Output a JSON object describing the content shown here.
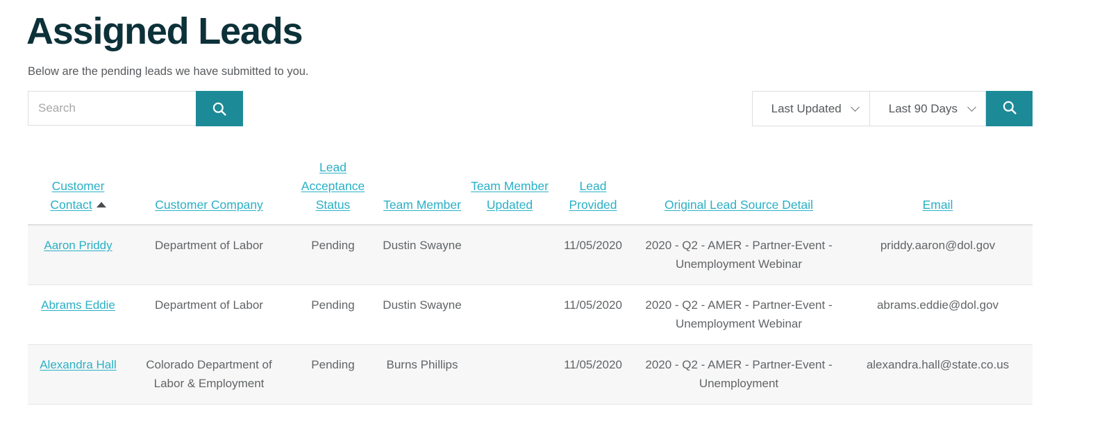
{
  "header": {
    "title": "Assigned Leads",
    "subtitle": "Below are the pending leads we have submitted to you."
  },
  "search": {
    "placeholder": "Search",
    "value": "",
    "button_icon": "search-icon"
  },
  "filters": {
    "sort_by": {
      "selected": "Last Updated",
      "icon": "chevron-down-icon"
    },
    "date_range": {
      "selected": "Last 90 Days",
      "icon": "chevron-down-icon"
    },
    "apply_icon": "search-icon"
  },
  "table": {
    "sorted_column": "Customer Contact",
    "sort_direction": "ascending",
    "columns": [
      "Customer Contact",
      "Customer Company",
      "Lead Acceptance Status",
      "Team Member",
      "Team Member Updated",
      "Lead Provided",
      "Original Lead Source Detail",
      "Email"
    ],
    "rows": [
      {
        "customer_contact": "Aaron Priddy",
        "customer_company": "Department of Labor",
        "lead_acceptance_status": "Pending",
        "team_member": "Dustin Swayne",
        "team_member_updated": "",
        "lead_provided": "11/05/2020",
        "original_lead_source_detail": "2020 - Q2 - AMER - Partner-Event - Unemployment Webinar",
        "email": "priddy.aaron@dol.gov"
      },
      {
        "customer_contact": "Abrams Eddie",
        "customer_company": "Department of Labor",
        "lead_acceptance_status": "Pending",
        "team_member": "Dustin Swayne",
        "team_member_updated": "",
        "lead_provided": "11/05/2020",
        "original_lead_source_detail": "2020 - Q2 - AMER - Partner-Event - Unemployment Webinar",
        "email": "abrams.eddie@dol.gov"
      },
      {
        "customer_contact": "Alexandra Hall",
        "customer_company": "Colorado Department of Labor & Employment",
        "lead_acceptance_status": "Pending",
        "team_member": "Burns Phillips",
        "team_member_updated": "",
        "lead_provided": "11/05/2020",
        "original_lead_source_detail": "2020 - Q2 - AMER - Partner-Event - Unemployment",
        "email": "alexandra.hall@state.co.us"
      }
    ]
  },
  "colors": {
    "brand_teal": "#1d8a97",
    "link_teal": "#29b0c6",
    "title_dark": "#0c3139",
    "body_text": "#616467",
    "row_alt_bg": "#f7f7f7"
  }
}
